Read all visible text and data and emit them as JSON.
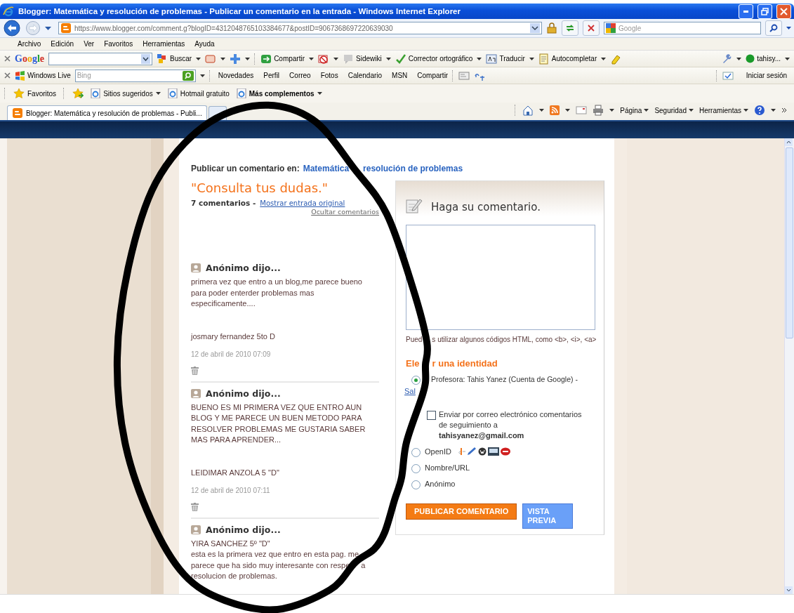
{
  "window": {
    "title": "Blogger: Matemática y resolución de problemas - Publicar un comentario en la entrada - Windows Internet Explorer"
  },
  "address_bar": {
    "url": "https://www.blogger.com/comment.g?blogID=4312048765103384677&postID=9067368697220639030"
  },
  "search_field": {
    "placeholder": "Google"
  },
  "menu_bar": [
    "Archivo",
    "Edición",
    "Ver",
    "Favoritos",
    "Herramientas",
    "Ayuda"
  ],
  "google_toolbar": {
    "logo": "Google",
    "buttons": [
      {
        "label": "Buscar"
      },
      {
        "label": "Compartir"
      },
      {
        "label": "Sidewiki"
      },
      {
        "label": "Corrector ortográfico"
      },
      {
        "label": "Traducir"
      },
      {
        "label": "Autocompletar"
      }
    ],
    "account": "tahisy..."
  },
  "live_toolbar": {
    "brand": "Windows Live",
    "search_placeholder": "Bing",
    "links": [
      "Novedades",
      "Perfil",
      "Correo",
      "Fotos",
      "Calendario",
      "MSN",
      "Compartir"
    ],
    "sign_in": "Iniciar sesión"
  },
  "favorites_bar": {
    "favorites": "Favoritos",
    "links": [
      {
        "label": "Sitios sugeridos",
        "bold": false,
        "has_menu": true
      },
      {
        "label": "Hotmail gratuito",
        "bold": false,
        "has_menu": false
      },
      {
        "label": "Más complementos",
        "bold": true,
        "has_menu": true
      }
    ]
  },
  "tabs": [
    {
      "label": "Blogger: Matemática y resolución de problemas - Publi...",
      "selected": true
    }
  ],
  "command_bar": [
    "Página",
    "Seguridad",
    "Herramientas"
  ],
  "page": {
    "heading": "Publicar un comentario en:",
    "blog_link": [
      "Matemática",
      "resolución de problemas"
    ],
    "post_title": "\"Consulta tus dudas.\"",
    "comment_count": "7 comentarios -",
    "show_post_link": "Mostrar entrada original",
    "hide_comments_link": "Ocultar comentarios",
    "comments": [
      {
        "author": "Anónimo dijo...",
        "body": [
          "primera vez que entro a un blog,me parece bueno para poder enterder problemas mas especificamente...."
        ],
        "signature": "josmary fernandez 5to D",
        "date": "12 de abril de 2010 07:09"
      },
      {
        "author": "Anónimo dijo...",
        "body": [
          "BUENO ES MI PRIMERA VEZ QUE ENTRO AUN BLOG Y ME PARECE UN BUEN METODO PARA RESOLVER PROBLEMAS ME GUSTARIA SABER MAS PARA APRENDER..."
        ],
        "signature": "LEIDIMAR ANZOLA 5 \"D\"",
        "date": "12 de abril de 2010 07:11"
      },
      {
        "author": "Anónimo dijo...",
        "lines": [
          [
            "YIRA SANCHEZ 5º \"D\""
          ],
          [
            "esta es la primera vez que entro en esta pag. me"
          ],
          [
            "parece que ha sido muy interesante con respe",
            "a"
          ],
          [
            "resolucion de problemas."
          ]
        ]
      }
    ]
  },
  "comment_form": {
    "title": "Haga su comentario.",
    "hint": [
      "Pued",
      "s utilizar algunos códigos HTML, como <b>, <i>, <a>"
    ],
    "identity_heading": [
      "Ele",
      "r una identidad"
    ],
    "identities": [
      {
        "kind": "account",
        "label": "Profesora: Tahis Yanez (Cuenta de Google) -",
        "link": "Sal",
        "selected": true
      },
      {
        "kind": "openid",
        "label": "OpenID",
        "selected": false
      },
      {
        "kind": "plain",
        "label": "Nombre/URL",
        "selected": false
      },
      {
        "kind": "plain",
        "label": "Anónimo",
        "selected": false
      }
    ],
    "follow_up": {
      "label": "Enviar por correo electrónico comentarios de seguimiento a **tahisyanez@gmail.com**",
      "checked": false
    },
    "buttons": [
      {
        "kind": "primary",
        "label": "PUBLICAR COMENTARIO"
      },
      {
        "kind": "secondary",
        "label": "VISTA PREVIA"
      }
    ]
  }
}
